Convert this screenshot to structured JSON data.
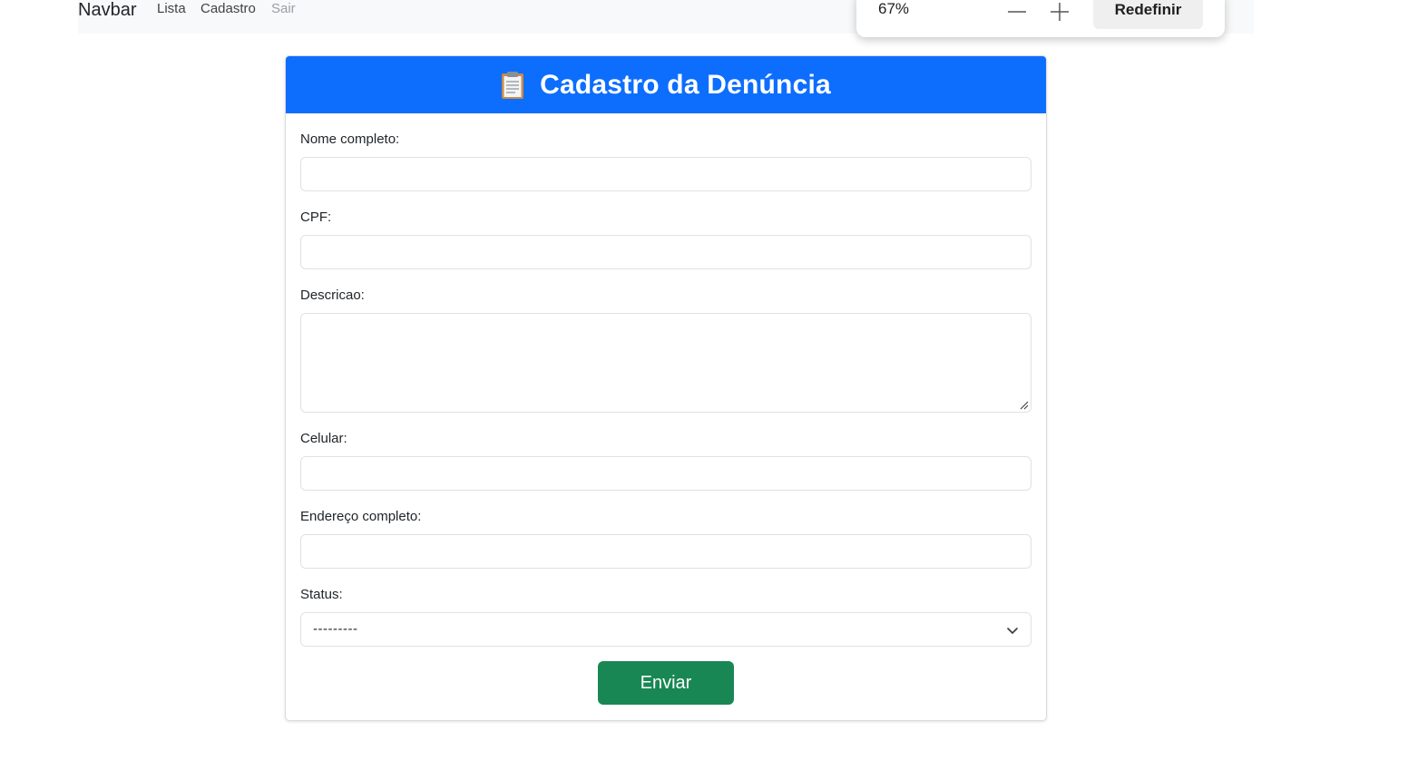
{
  "navbar": {
    "brand": "Navbar",
    "links": [
      "Lista",
      "Cadastro",
      "Sair"
    ]
  },
  "zoom_popup": {
    "level": "67%",
    "minus_icon": "minus-icon",
    "plus_icon": "plus-icon",
    "reset_label": "Redefinir"
  },
  "form": {
    "title": "Cadastro da Denúncia",
    "title_icon": "clipboard-icon",
    "header_color": "#0d6efd",
    "fields": {
      "nome_label": "Nome completo:",
      "cpf_label": "CPF:",
      "descricao_label": "Descricao:",
      "celular_label": "Celular:",
      "endereco_label": "Endereço completo:",
      "status_label": "Status:"
    },
    "status_value": "---------",
    "submit_label": "Enviar",
    "submit_color": "#198754"
  }
}
